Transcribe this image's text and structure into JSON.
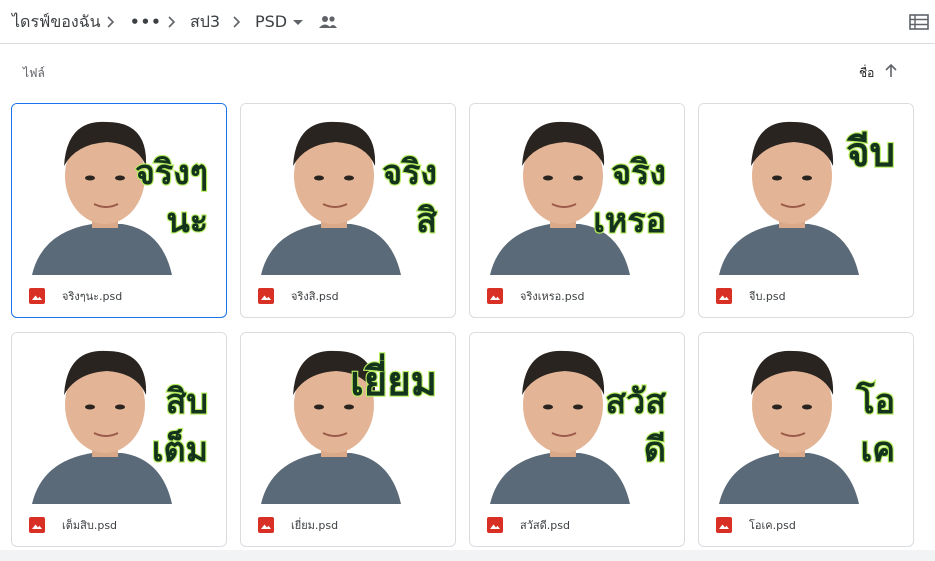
{
  "breadcrumb": {
    "root": "ไดรฟ์ของฉัน",
    "more": "•••",
    "folder": "สป3",
    "current": "PSD"
  },
  "icons": {
    "chevron": "chevron-right-icon",
    "caret": "caret-down-icon",
    "shared": "people-icon",
    "view": "list-view-icon",
    "sort": "arrow-up-icon",
    "file": "image-file-icon"
  },
  "colors": {
    "file_icon": "#d93025",
    "selected_border": "#1a73e8",
    "sticker_fill": "#13331d",
    "sticker_glow": "#b8ee60"
  },
  "files_section": {
    "label": "ไฟล์",
    "sort_label": "ชื่อ"
  },
  "files": [
    {
      "name": "จริงๆนะ.psd",
      "caption_line1": "จริงๆ",
      "caption_line2": "นะ",
      "selected": true
    },
    {
      "name": "จริงสิ.psd",
      "caption_line1": "จริง",
      "caption_line2": "สิ",
      "selected": false
    },
    {
      "name": "จริงเหรอ.psd",
      "caption_line1": "จริง",
      "caption_line2": "เหรอ",
      "selected": false
    },
    {
      "name": "จีบ.psd",
      "caption_line1": "จีบ",
      "caption_line2": "",
      "selected": false
    },
    {
      "name": "เต็มสิบ.psd",
      "caption_line1": "สิบ",
      "caption_line2": "เต็ม",
      "selected": false
    },
    {
      "name": "เยี่ยม.psd",
      "caption_line1": "เยี่ยม",
      "caption_line2": "",
      "selected": false
    },
    {
      "name": "สวัสดี.psd",
      "caption_line1": "สวัส",
      "caption_line2": "ดี",
      "selected": false
    },
    {
      "name": "โอเค.psd",
      "caption_line1": "โอ",
      "caption_line2": "เค",
      "selected": false
    }
  ]
}
